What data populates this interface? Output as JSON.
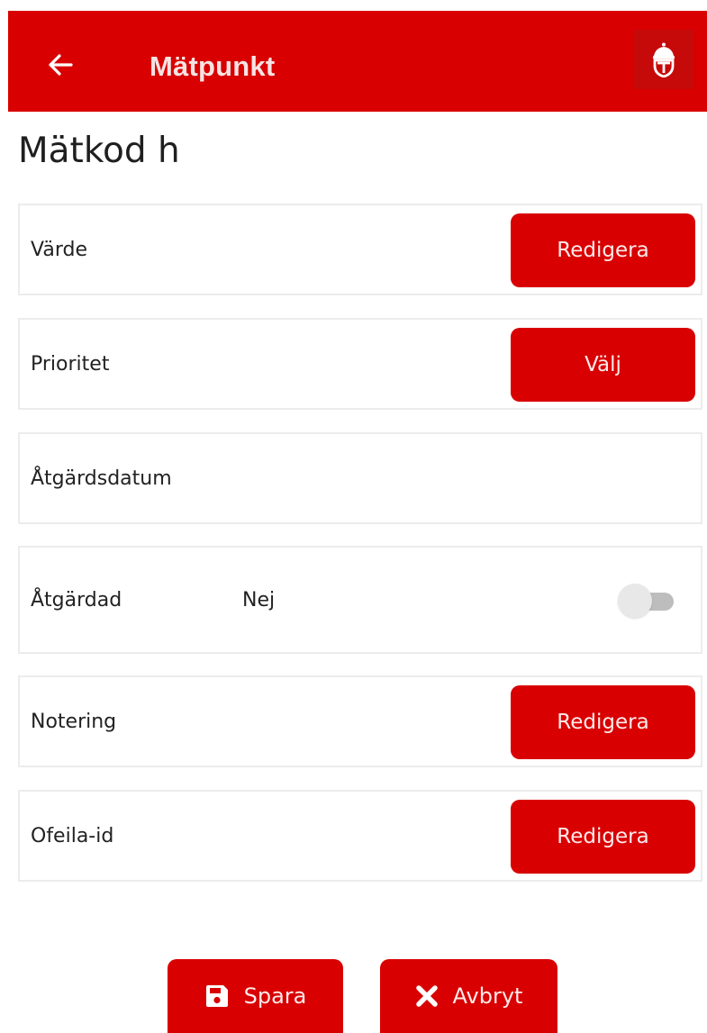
{
  "appbar": {
    "title": "Mätpunkt",
    "back_icon": "arrow-left-icon",
    "logo_icon": "crown-emblem-icon",
    "color": "#d80000"
  },
  "page": {
    "heading": "Mätkod h"
  },
  "rows": [
    {
      "label": "Värde",
      "button": "Redigera"
    },
    {
      "label": "Prioritet",
      "button": "Välj"
    },
    {
      "label": "Åtgärdsdatum"
    },
    {
      "label": "Åtgärdad",
      "value": "Nej",
      "toggle_on": false
    },
    {
      "label": "Notering",
      "button": "Redigera"
    },
    {
      "label": "Ofeila-id",
      "button": "Redigera"
    }
  ],
  "footer": {
    "save_label": "Spara",
    "save_icon": "floppy-disk-icon",
    "cancel_label": "Avbryt",
    "cancel_icon": "close-x-icon"
  }
}
